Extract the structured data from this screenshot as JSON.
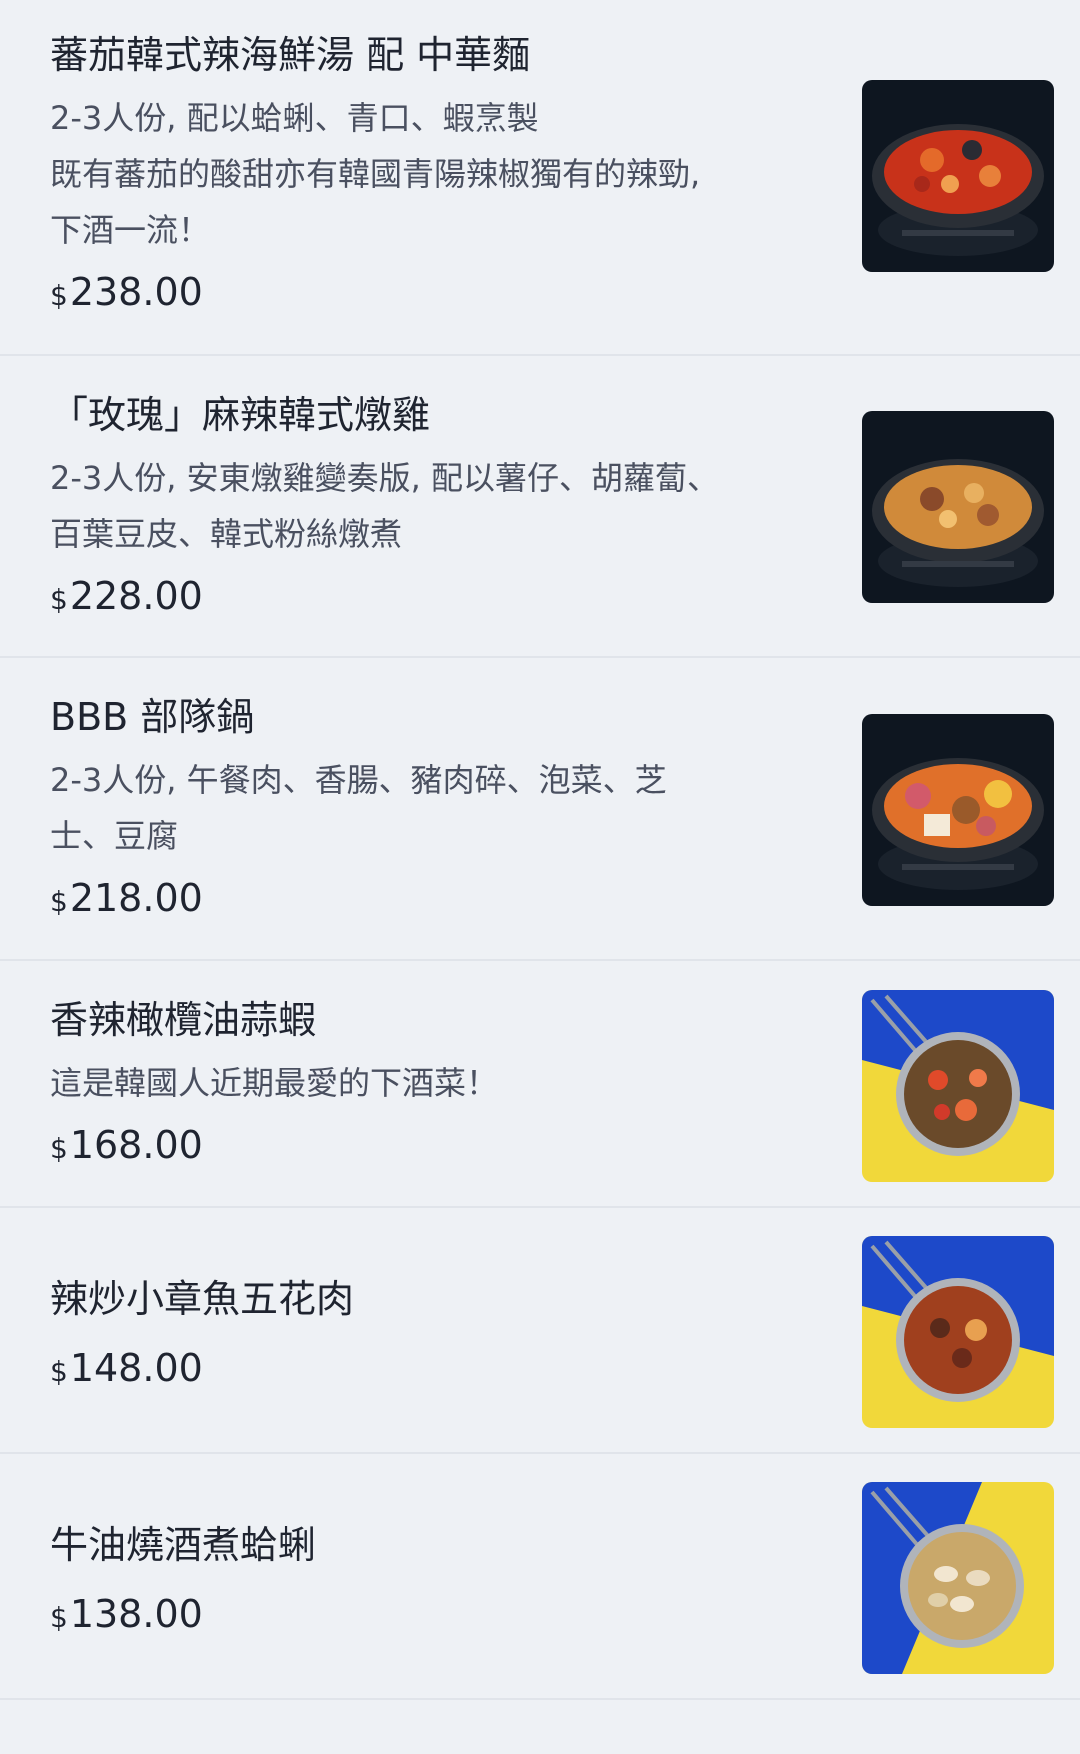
{
  "menu": {
    "items": [
      {
        "name": "蕃茄韓式辣海鮮湯 配 中華麵",
        "desc": [
          "2-3人份, 配以蛤蜊、青口、蝦烹製",
          "既有蕃茄的酸甜亦有韓國青陽辣椒獨有的辣勁,",
          "下酒一流！"
        ],
        "currency": "$",
        "price": "238.00",
        "image_icon": "tomato-seafood-stew-image"
      },
      {
        "name": "「玫瑰」麻辣韓式燉雞",
        "desc": [
          "2-3人份, 安東燉雞變奏版, 配以薯仔、胡蘿蔔、",
          "百葉豆皮、韓式粉絲燉煮"
        ],
        "currency": "$",
        "price": "228.00",
        "image_icon": "braised-chicken-image"
      },
      {
        "name": "BBB 部隊鍋",
        "desc": [
          "2-3人份, 午餐肉、香腸、豬肉碎、泡菜、芝",
          "士、豆腐"
        ],
        "currency": "$",
        "price": "218.00",
        "image_icon": "army-stew-image"
      },
      {
        "name": "香辣橄欖油蒜蝦",
        "desc": [
          "這是韓國人近期最愛的下酒菜！"
        ],
        "currency": "$",
        "price": "168.00",
        "image_icon": "garlic-shrimp-image"
      },
      {
        "name": "辣炒小章魚五花肉",
        "desc": [],
        "currency": "$",
        "price": "148.00",
        "image_icon": "octopus-pork-image"
      },
      {
        "name": "牛油燒酒煮蛤蜊",
        "desc": [],
        "currency": "$",
        "price": "138.00",
        "image_icon": "soju-clams-image"
      }
    ]
  },
  "colors": {
    "background": "#eef1f5",
    "divider": "#e0e4ea",
    "text": "#1f2430",
    "subtext": "#4a5060",
    "blue": "#1d49c9",
    "yellow": "#f1d83a"
  }
}
